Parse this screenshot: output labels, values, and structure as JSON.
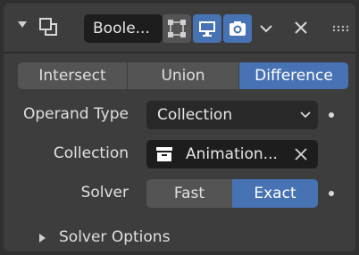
{
  "header": {
    "name": "Boole...",
    "icons": [
      "collapse-arrow-icon",
      "modifier-type-icon",
      "edit-mode-icon",
      "viewport-display-icon",
      "render-camera-icon",
      "chevron-down-icon",
      "close-icon",
      "drag-handle-icon"
    ]
  },
  "operation": {
    "options": [
      "Intersect",
      "Union",
      "Difference"
    ],
    "selected": "Difference"
  },
  "operand_type": {
    "label": "Operand Type",
    "value": "Collection"
  },
  "collection": {
    "label": "Collection",
    "value": "Animation..."
  },
  "solver": {
    "label": "Solver",
    "options": [
      "Fast",
      "Exact"
    ],
    "selected": "Exact"
  },
  "subpanel": {
    "label": "Solver Options"
  },
  "colors": {
    "accent": "#4772b3",
    "panel": "#3d3d3d",
    "background": "#303030",
    "button": "#545454",
    "field": "#1d1d1d"
  }
}
